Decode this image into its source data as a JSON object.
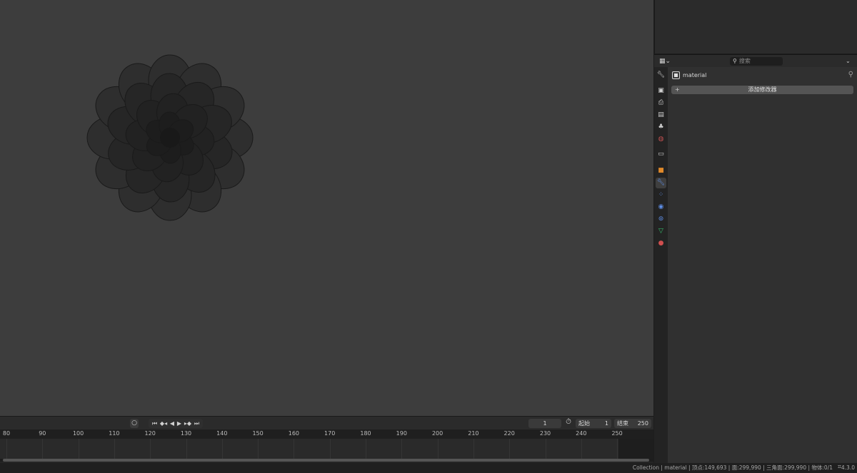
{
  "timeline": {
    "record_icon": "record-icon",
    "playback": [
      {
        "name": "jump-start-icon",
        "glyph": "⏮"
      },
      {
        "name": "jump-keyframe-prev-icon",
        "glyph": "◆◂"
      },
      {
        "name": "play-reverse-icon",
        "glyph": "◀"
      },
      {
        "name": "play-icon",
        "glyph": "▶"
      },
      {
        "name": "jump-keyframe-next-icon",
        "glyph": "▸◆"
      },
      {
        "name": "jump-end-icon",
        "glyph": "⏭"
      }
    ],
    "current_frame": "1",
    "start_label": "起始",
    "start_value": "1",
    "end_label": "结束",
    "end_value": "250",
    "ruler": [
      "80",
      "90",
      "100",
      "110",
      "120",
      "130",
      "140",
      "150",
      "160",
      "170",
      "180",
      "190",
      "200",
      "210",
      "220",
      "230",
      "240",
      "250"
    ]
  },
  "properties": {
    "editor_type_icon": "properties-editor-icon",
    "search_placeholder": "搜索",
    "object_name": "material",
    "add_modifier_label": "添加修改器",
    "tabs": [
      {
        "name": "tool-icon",
        "glyph": "🔧︎",
        "color": "#d0d0d0"
      },
      {
        "name": "render-icon",
        "glyph": "▣",
        "color": "#d0d0d0"
      },
      {
        "name": "output-icon",
        "glyph": "⎙",
        "color": "#d0d0d0"
      },
      {
        "name": "view-layer-icon",
        "glyph": "▤",
        "color": "#d0d0d0"
      },
      {
        "name": "scene-icon",
        "glyph": "♣",
        "color": "#d0d0d0"
      },
      {
        "name": "world-icon",
        "glyph": "◍",
        "color": "#c05050"
      },
      {
        "name": "collection-icon",
        "glyph": "▭",
        "color": "#d0d0d0"
      },
      {
        "name": "object-icon",
        "glyph": "■",
        "color": "#e0892a"
      },
      {
        "name": "modifier-icon",
        "glyph": "🔧︎",
        "color": "#5e8ee6"
      },
      {
        "name": "particles-icon",
        "glyph": "⁘",
        "color": "#5e8ee6"
      },
      {
        "name": "physics-icon",
        "glyph": "◉",
        "color": "#5e8ee6"
      },
      {
        "name": "constraints-icon",
        "glyph": "⊚",
        "color": "#5e8ee6"
      },
      {
        "name": "data-icon",
        "glyph": "▽",
        "color": "#35c26f"
      },
      {
        "name": "material-icon",
        "glyph": "●",
        "color": "#d04f4f"
      }
    ]
  },
  "statusbar": {
    "text": "Collection | material | 顶点:149,693 | 面:299,990 | 三角面:299,990 | 物体:0/1",
    "version": "4.3.0"
  }
}
